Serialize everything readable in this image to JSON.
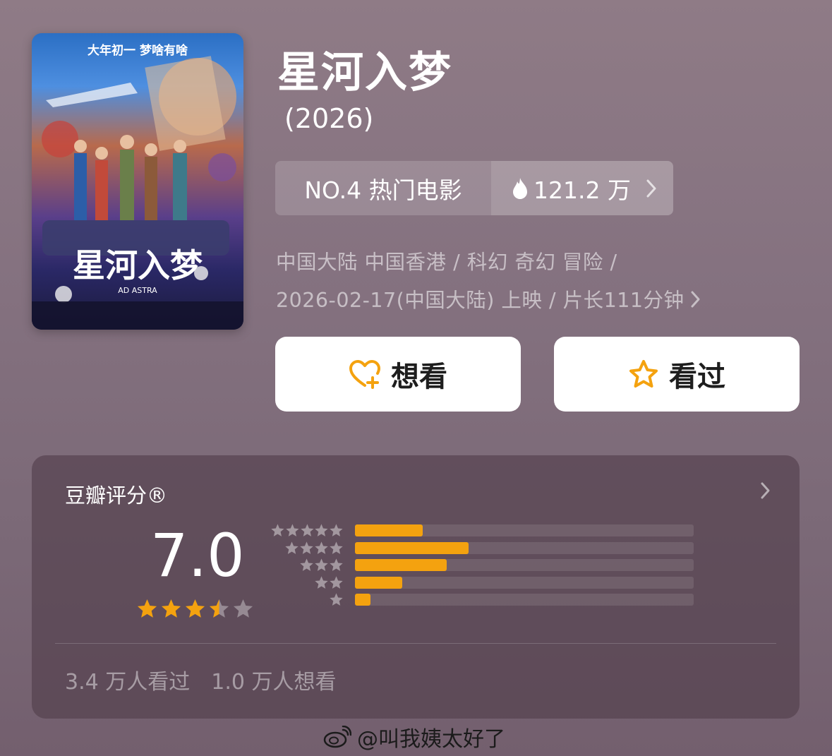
{
  "movie": {
    "title": "星河入梦",
    "year": "(2026)",
    "rank_label": "NO.4 热门电影",
    "heat": "121.2 万",
    "meta_line1": "中国大陆 中国香港 / 科幻 奇幻 冒险 /",
    "meta_line2": "2026-02-17(中国大陆) 上映 / 片长111分钟",
    "poster_slogan": "大年初一 梦啥有啥",
    "poster_title": "星河入梦",
    "poster_subtitle": "AD ASTRA"
  },
  "actions": {
    "want_label": "想看",
    "seen_label": "看过"
  },
  "rating": {
    "title": "豆瓣评分®",
    "score": "7.0",
    "star_value": 3.5,
    "distribution": [
      {
        "stars": 5,
        "percent": 20
      },
      {
        "stars": 4,
        "percent": 33.5
      },
      {
        "stars": 3,
        "percent": 27
      },
      {
        "stars": 2,
        "percent": 14
      },
      {
        "stars": 1,
        "percent": 4.5
      }
    ],
    "seen_count": "3.4 万人看过",
    "want_count": "1.0 万人想看"
  },
  "watermark": "@叫我姨太好了",
  "colors": {
    "accent_orange": "#f4a20f",
    "button_bg": "#ffffff",
    "background": "#857280"
  }
}
